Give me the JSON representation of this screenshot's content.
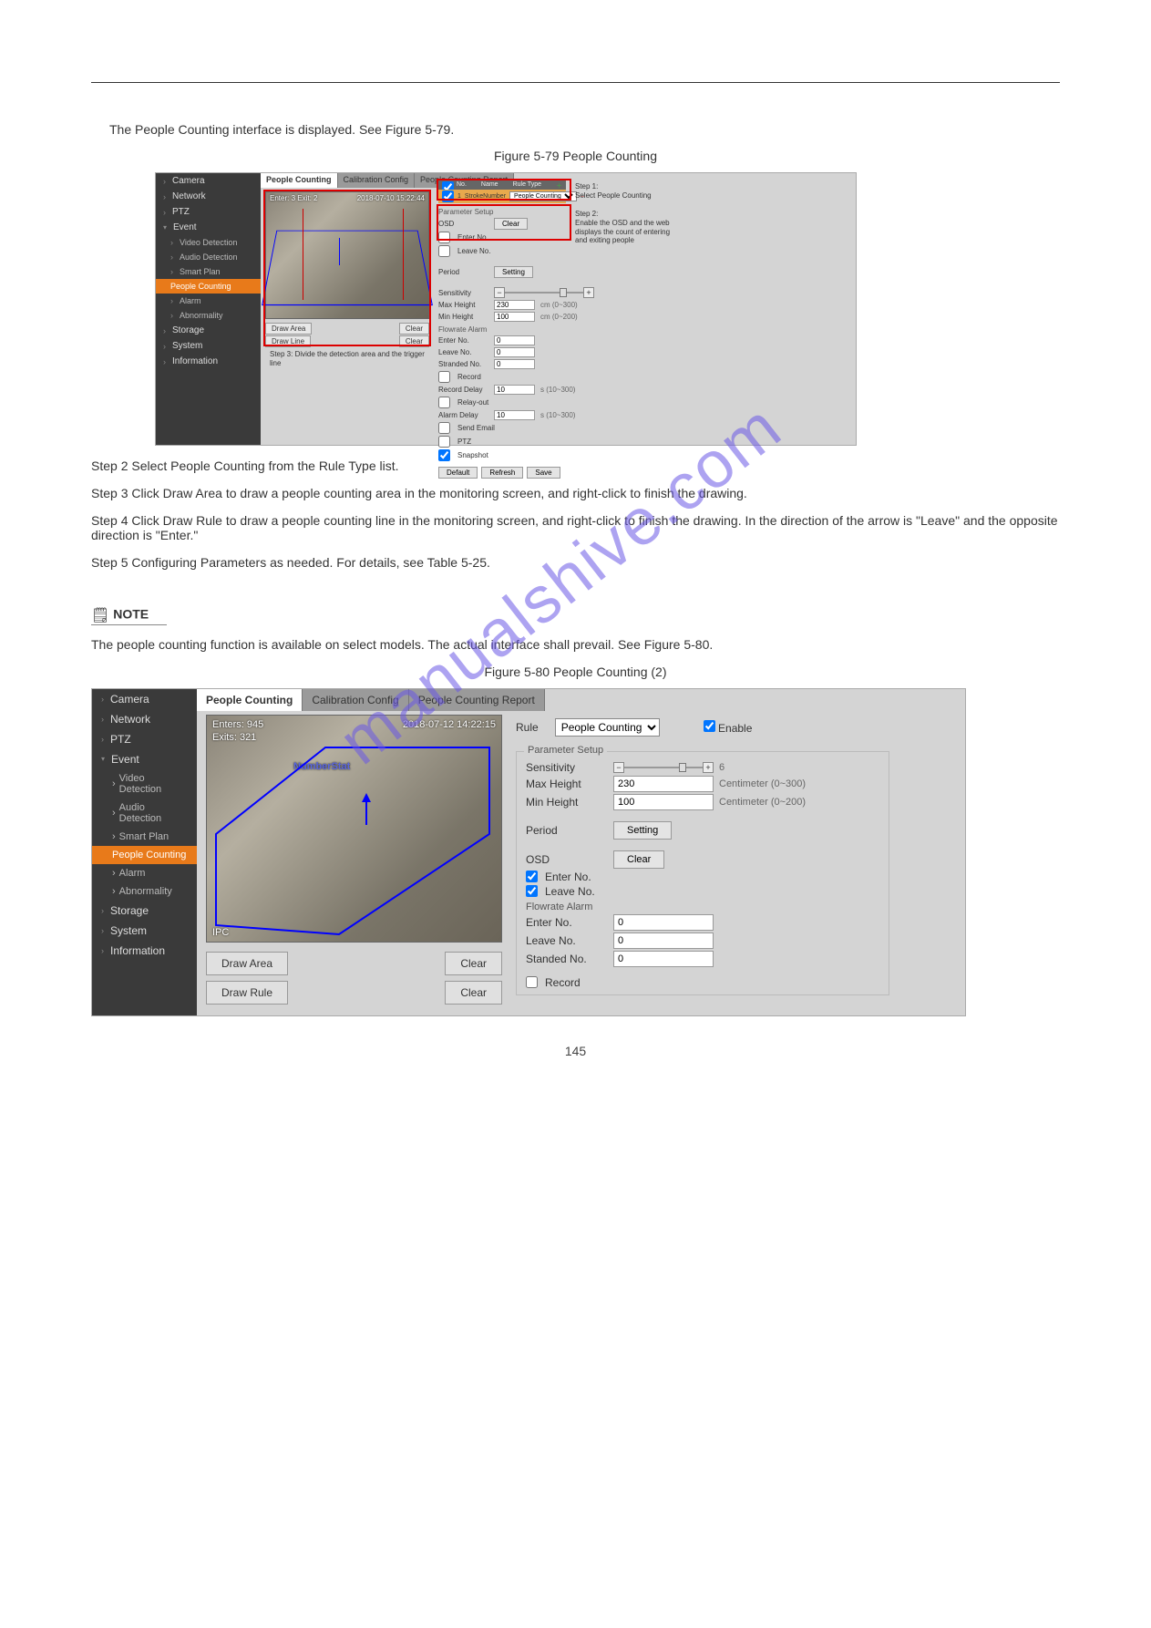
{
  "topText": "The People Counting interface is displayed. See Figure 5-79.",
  "fig1": {
    "label": "Figure 5-79 People Counting"
  },
  "sidebar": {
    "items": [
      "Camera",
      "Network",
      "PTZ",
      "Event",
      "Video Detection",
      "Audio Detection",
      "Smart Plan",
      "People Counting",
      "Alarm",
      "Abnormality",
      "Storage",
      "System",
      "Information"
    ]
  },
  "tabs": {
    "t1": "People Counting",
    "t2": "Calibration Config",
    "t3": "People Counting Report"
  },
  "shot1": {
    "ruleHdr": {
      "c1": "No.",
      "c2": "Name",
      "c3": "Rule Type"
    },
    "ruleRow": {
      "no": "1",
      "name": "StrokeNumber",
      "type": "People Counting"
    },
    "paramSetup": "Parameter Setup",
    "osd": "OSD",
    "clear": "Clear",
    "enterNoChk": "Enter No.",
    "leaveNoChk": "Leave No.",
    "period": "Period",
    "setting": "Setting",
    "sensitivity": "Sensitivity",
    "maxHeight": "Max Height",
    "maxHeightVal": "230",
    "maxHeightUnit": "cm (0~300)",
    "minHeight": "Min Height",
    "minHeightVal": "100",
    "minHeightUnit": "cm (0~200)",
    "flowrate": "Flowrate Alarm",
    "enterNo": "Enter No.",
    "enterNoVal": "0",
    "leaveNo": "Leave No.",
    "leaveNoVal": "0",
    "strandedNo": "Stranded No.",
    "strandedNoVal": "0",
    "record": "Record",
    "recordDelay": "Record Delay",
    "recordDelayVal": "10",
    "recordDelayUnit": "s (10~300)",
    "relayOut": "Relay-out",
    "alarmDelay": "Alarm Delay",
    "alarmDelayVal": "10",
    "alarmDelayUnit": "s (10~300)",
    "sendEmail": "Send Email",
    "ptz": "PTZ",
    "snapshot": "Snapshot",
    "default": "Default",
    "refresh": "Refresh",
    "save": "Save",
    "drawArea": "Draw Area",
    "drawLine": "Draw Line",
    "step1": "Step 1:\nSelect People Counting",
    "step2": "Step 2:\nEnable the OSD and the web displays the count of entering and exiting people",
    "step3": "Step 3: Divide the detection area and the trigger line",
    "osdEnter": "Enter: 3  Exit: 2",
    "osdTime": "2018-07-10 15:22:44"
  },
  "midText1": "Step 2  Select People Counting from the Rule Type list.",
  "midText2": "Step 3  Click Draw Area to draw a people counting area in the monitoring screen, and right-click to finish the drawing.",
  "midText3": "Step 4  Click Draw Rule to draw a people counting line in the monitoring screen, and right-click to finish the drawing. In the direction of the arrow is \"Leave\" and the opposite direction is \"Enter.\"",
  "midText5": "Step 5  Configuring Parameters as needed. For details, see Table 5-25.",
  "noteHead": "NOTE",
  "noteBody": "The people counting function is available on select models. The actual interface shall prevail. See Figure 5-80.",
  "fig2": {
    "label": "Figure 5-80 People Counting (2)"
  },
  "shot2": {
    "rule": "Rule",
    "ruleVal": "People Counting",
    "enable": "Enable",
    "paramSetup": "Parameter Setup",
    "sensitivity": "Sensitivity",
    "sensVal": "6",
    "maxHeight": "Max Height",
    "maxHeightVal": "230",
    "maxHeightUnit": "Centimeter (0~300)",
    "minHeight": "Min Height",
    "minHeightVal": "100",
    "minHeightUnit": "Centimeter (0~200)",
    "period": "Period",
    "setting": "Setting",
    "osd": "OSD",
    "clear": "Clear",
    "enterNoChk": "Enter No.",
    "leaveNoChk": "Leave No.",
    "flowrate": "Flowrate Alarm",
    "enterNo": "Enter No.",
    "enterNoVal": "0",
    "leaveNo": "Leave No.",
    "leaveNoVal": "0",
    "strandedNo": "Standed No.",
    "strandedNoVal": "0",
    "record": "Record",
    "drawArea": "Draw Area",
    "drawRule": "Draw Rule",
    "osdEnter": "Enters: 945",
    "osdExit": "Exits: 321",
    "osdTime": "2018-07-12 14:22:15",
    "osdLabel": "NumberStat",
    "ipc": "IPC"
  },
  "pageNum": "145"
}
